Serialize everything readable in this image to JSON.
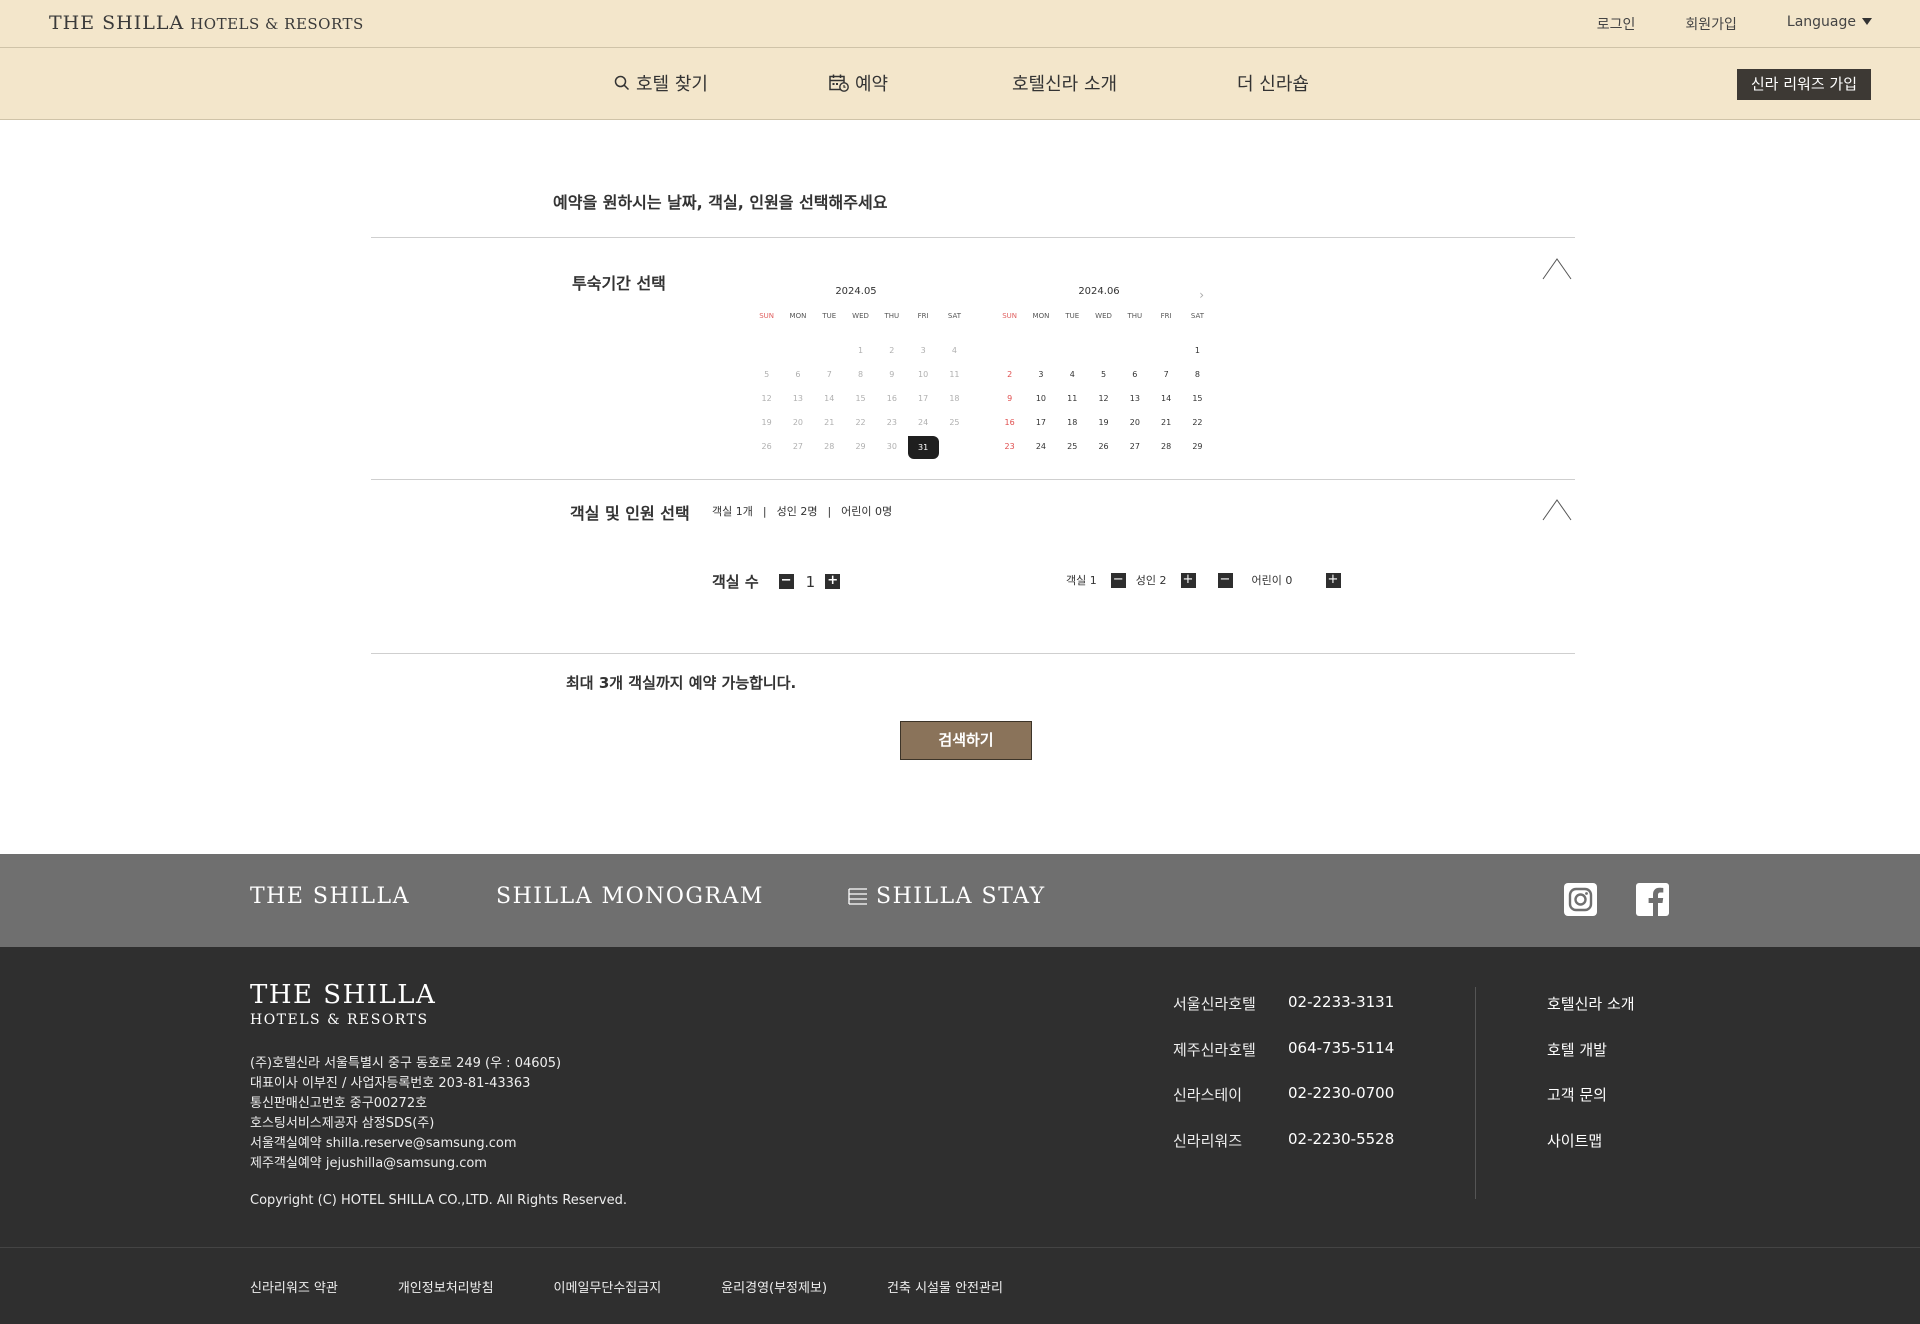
{
  "header": {
    "logo_main": "THE SHILLA",
    "logo_sub": "HOTELS & RESORTS",
    "login": "로그인",
    "signup": "회원가입",
    "language": "Language"
  },
  "nav": {
    "find_hotel": "호텔 찾기",
    "reservation": "예약",
    "about": "호텔신라 소개",
    "shop": "더 신라숍",
    "rewards_join": "신라 리워즈 가입"
  },
  "main": {
    "title": "예약을 원하시는 날짜, 객실, 인원을 선택해주세요",
    "stay_section_title": "투숙기간 선택",
    "room_section_title": "객실 및 인원 선택",
    "summary": {
      "rooms": "객실 1개",
      "adults": "성인 2명",
      "children": "어린이 0명",
      "sep": "|"
    },
    "room_count_label": "객실 수",
    "room_count_value": "1",
    "room1_label": "객실 1",
    "adults_label": "성인 2",
    "children_label": "어린이 0",
    "max_note": "최대 3개 객실까지 예약 가능합니다.",
    "search_button": "검색하기"
  },
  "calendar": {
    "weekdays": [
      "SUN",
      "MON",
      "TUE",
      "WED",
      "THU",
      "FRI",
      "SAT"
    ],
    "months": [
      {
        "label": "2024.05",
        "first_weekday": 3,
        "days": 31,
        "selected": 31,
        "available_from": 31
      },
      {
        "label": "2024.06",
        "first_weekday": 6,
        "days": 29,
        "selected": null,
        "available_from": 1
      }
    ]
  },
  "footer": {
    "brands": [
      "THE SHILLA",
      "SHILLA MONOGRAM",
      "SHILLA STAY"
    ],
    "social": [
      "instagram-icon",
      "facebook-icon"
    ],
    "logo_main": "THE SHILLA",
    "logo_sub": "HOTELS & RESORTS",
    "info_lines": [
      "(주)호텔신라 서울특별시 중구 동호로 249 (우 : 04605)",
      "대표이사 이부진 / 사업자등록번호 203-81-43363",
      "통신판매신고번호 중구00272호",
      "호스팅서비스제공자 삼정SDS(주)",
      "서울객실예약 shilla.reserve@samsung.com",
      "제주객실예약 jejushilla@samsung.com"
    ],
    "copyright": "Copyright (C) HOTEL SHILLA CO.,LTD. All Rights Reserved.",
    "contacts": [
      {
        "name": "서울신라호텔",
        "phone": "02-2233-3131"
      },
      {
        "name": "제주신라호텔",
        "phone": "064-735-5114"
      },
      {
        "name": "신라스테이",
        "phone": "02-2230-0700"
      },
      {
        "name": "신라리워즈",
        "phone": "02-2230-5528"
      }
    ],
    "links": [
      "호텔신라 소개",
      "호텔 개발",
      "고객 문의",
      "사이트맵"
    ],
    "bottom_links": [
      "신라리워즈 약관",
      "개인정보처리방침",
      "이메일무단수집금지",
      "윤리경영(부정제보)",
      "건축 시설물 안전관리"
    ]
  }
}
